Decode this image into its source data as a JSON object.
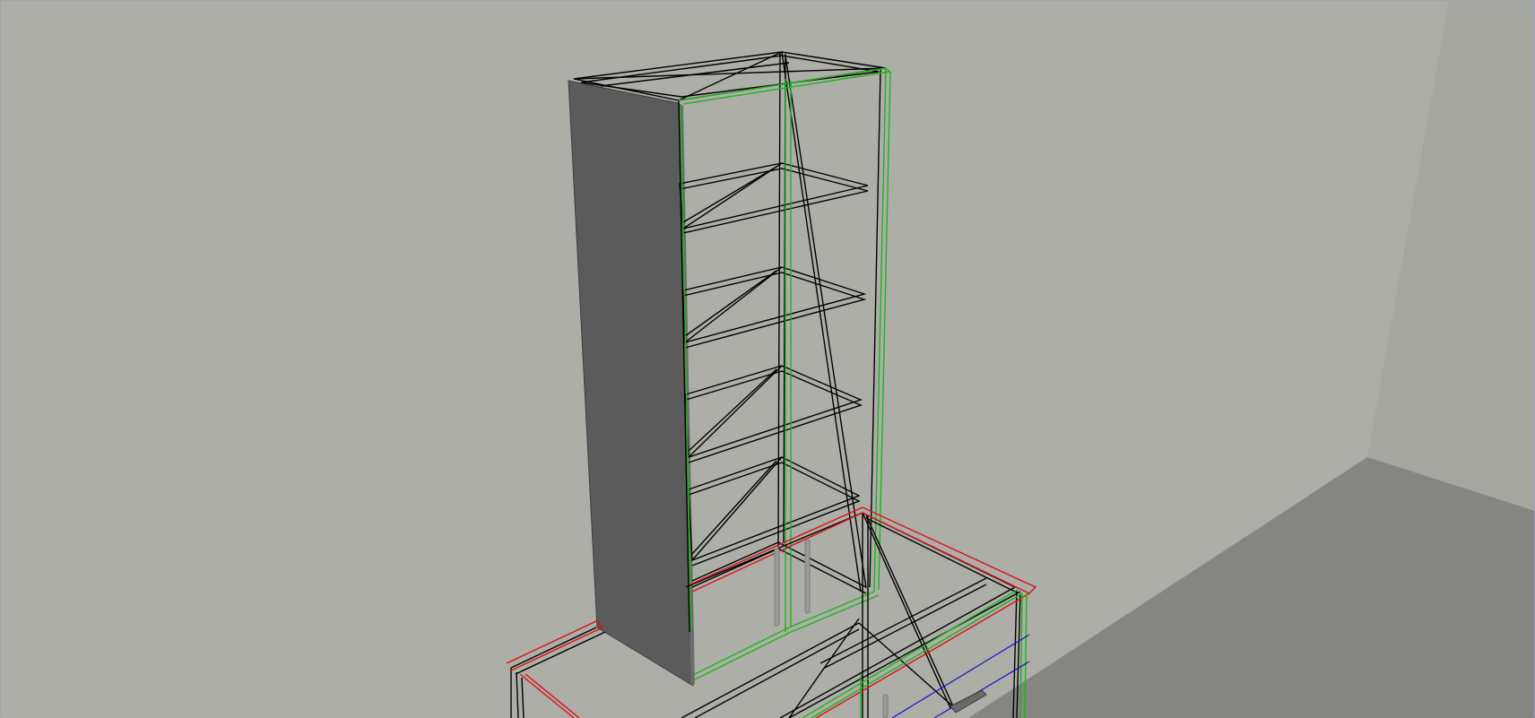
{
  "viewport": {
    "view_mode": "3d-perspective",
    "render_style": "wireframe-with-shaded-side-panel"
  },
  "scene": {
    "room": {
      "back_wall_color": "#aeaea8",
      "right_wall_color": "#a6a6a1",
      "floor_color": "#858582"
    },
    "objects": [
      {
        "name": "tall-cabinet",
        "shelf_count": 4,
        "side_panel_color": "#5b5b5b"
      },
      {
        "name": "base-cabinet",
        "handle_count": 2
      },
      {
        "name": "lower-cabinet",
        "handle_count": 1
      }
    ],
    "highlight_colors": {
      "wire": "#000000",
      "green": "#1db51d",
      "red": "#dd1111",
      "blue": "#1111cc",
      "handle": "#9a9a9a"
    }
  }
}
